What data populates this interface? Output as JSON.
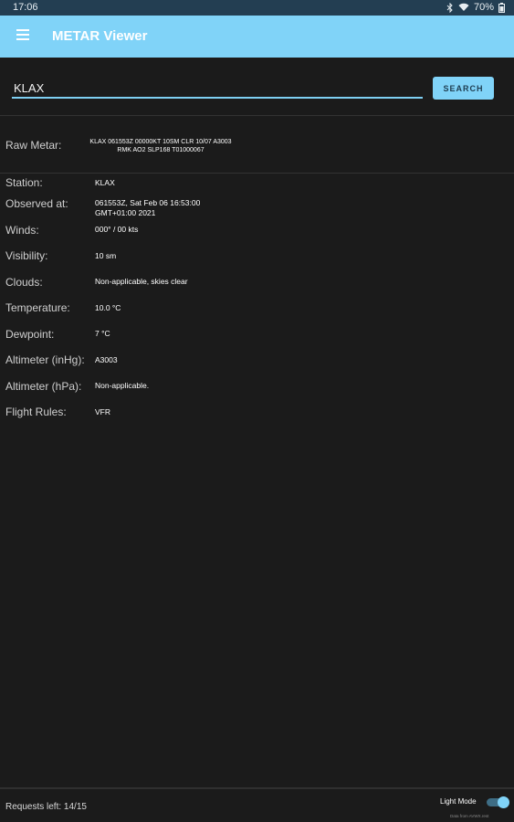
{
  "status_bar": {
    "time": "17:06",
    "battery": "70%"
  },
  "app_bar": {
    "title": "METAR Viewer"
  },
  "search": {
    "value": "KLAX",
    "button_label": "SEARCH"
  },
  "raw_metar": {
    "label": "Raw Metar:",
    "line1": "KLAX 061553Z 00000KT 10SM CLR 10/07 A3003",
    "line2": "RMK AO2 SLP168 T01000067"
  },
  "details": [
    {
      "label": "Station:",
      "value": "KLAX"
    },
    {
      "label": "Observed at:",
      "value": "061553Z, Sat Feb 06 16:53:00",
      "value2": "GMT+01:00 2021"
    },
    {
      "label": "Winds:",
      "value": "000° / 00 kts"
    },
    {
      "label": "Visibility:",
      "value": "10 sm"
    },
    {
      "label": "Clouds:",
      "value": "Non-applicable, skies clear"
    },
    {
      "label": "Temperature:",
      "value": "10.0 °C"
    },
    {
      "label": "Dewpoint:",
      "value": "7 °C"
    },
    {
      "label": "Altimeter (inHg):",
      "value": "A3003"
    },
    {
      "label": "Altimeter (hPa):",
      "value": "Non-applicable."
    },
    {
      "label": "Flight Rules:",
      "value": "VFR"
    }
  ],
  "footer": {
    "requests": "Requests left: 14/15",
    "light_mode_label": "Light Mode",
    "light_mode_on": true,
    "credit": "Data from AVWX.rest"
  },
  "colors": {
    "accent": "#80d3f8",
    "background": "#1b1b1b",
    "status_bar": "#233e52"
  },
  "icons": [
    "menu-icon",
    "bluetooth-icon",
    "wifi-icon",
    "battery-icon"
  ]
}
